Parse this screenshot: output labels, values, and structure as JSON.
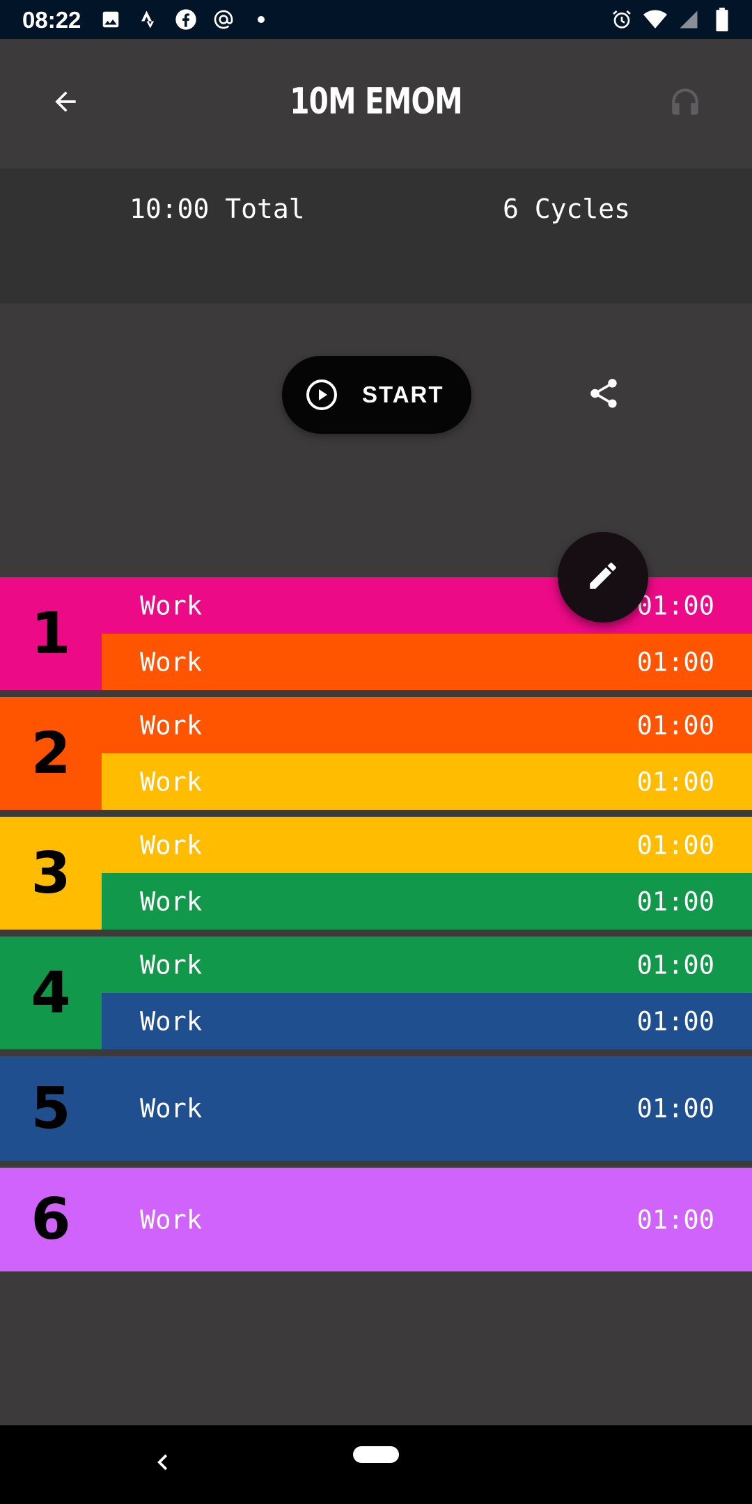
{
  "status_bar": {
    "time": "08:22",
    "left_icons": [
      "image-icon",
      "strava-icon",
      "facebook-icon",
      "at-icon",
      "dot-icon"
    ],
    "right_icons": [
      "alarm-icon",
      "wifi-icon",
      "signal-icon",
      "battery-icon"
    ]
  },
  "app_bar": {
    "title": "10M EMOM",
    "back_icon": "arrow-back-icon",
    "audio_icon": "headphones-icon"
  },
  "summary": {
    "total": "10:00 Total",
    "cycles": "6 Cycles"
  },
  "actions": {
    "start_label": "START",
    "start_icon": "play-circle-icon",
    "share_icon": "share-icon",
    "edit_icon": "pencil-icon"
  },
  "colors": {
    "pink": "#ed0a87",
    "orange": "#ff5500",
    "amber": "#ffbc00",
    "green": "#11984a",
    "blue": "#1f4f8e",
    "purple": "#cf63fb",
    "background": "#3c3a3b",
    "summary_bg": "#333233"
  },
  "cycles": [
    {
      "number": "1",
      "rows": [
        {
          "label": "Work",
          "time": "01:00"
        },
        {
          "label": "Work",
          "time": "01:00"
        }
      ]
    },
    {
      "number": "2",
      "rows": [
        {
          "label": "Work",
          "time": "01:00"
        },
        {
          "label": "Work",
          "time": "01:00"
        }
      ]
    },
    {
      "number": "3",
      "rows": [
        {
          "label": "Work",
          "time": "01:00"
        },
        {
          "label": "Work",
          "time": "01:00"
        }
      ]
    },
    {
      "number": "4",
      "rows": [
        {
          "label": "Work",
          "time": "01:00"
        },
        {
          "label": "Work",
          "time": "01:00"
        }
      ]
    },
    {
      "number": "5",
      "rows": [
        {
          "label": "Work",
          "time": "01:00"
        }
      ]
    },
    {
      "number": "6",
      "rows": [
        {
          "label": "Work",
          "time": "01:00"
        }
      ]
    }
  ]
}
